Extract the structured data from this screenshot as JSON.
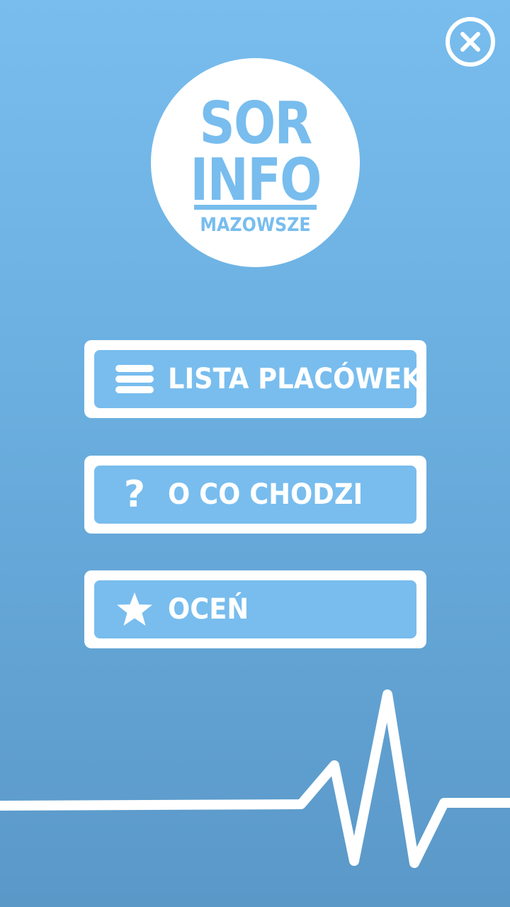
{
  "header": {
    "close_icon": "close-icon"
  },
  "logo": {
    "line1": "SOR",
    "line2": "INFO",
    "subtitle": "MAZOWSZE"
  },
  "menu": [
    {
      "label": "LISTA PLACÓWEK",
      "icon": "list-icon"
    },
    {
      "label": "O CO CHODZI",
      "icon": "question-icon"
    },
    {
      "label": "OCEŃ",
      "icon": "star-icon"
    }
  ],
  "colors": {
    "background_top": "#78bdee",
    "background_bottom": "#5a98c8",
    "accent": "#78bdee",
    "foreground": "#ffffff"
  },
  "decoration": "ecg-line"
}
